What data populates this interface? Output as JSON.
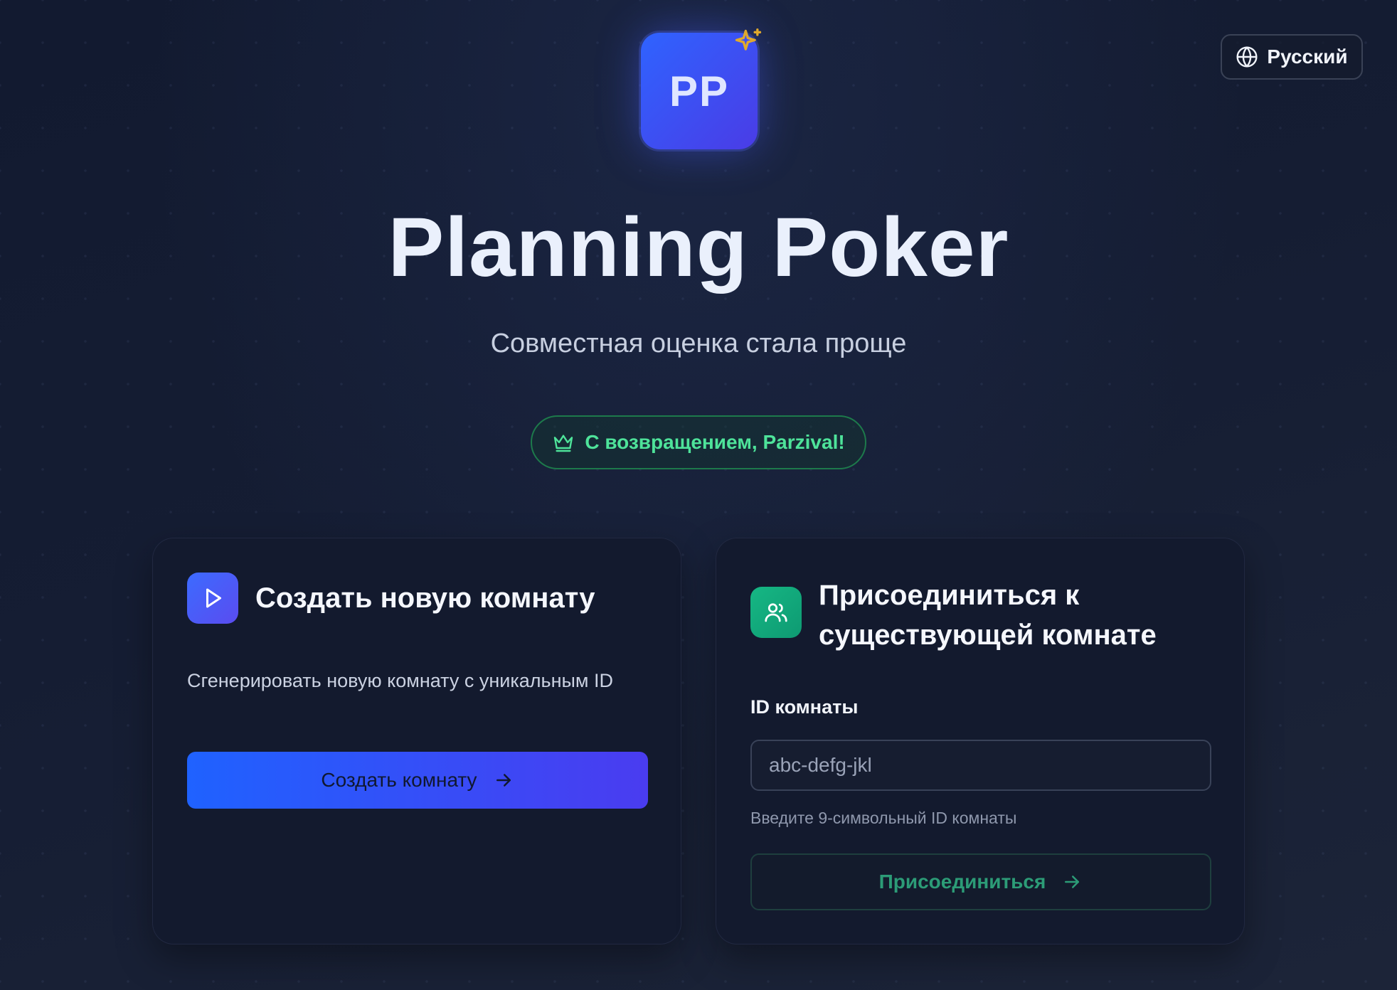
{
  "header": {
    "language_label": "Русский",
    "logo_text": "PP",
    "title": "Planning Poker",
    "subtitle": "Совместная оценка стала проще",
    "welcome": "С возвращением, Parzival!"
  },
  "create_card": {
    "title": "Создать новую комнату",
    "description": "Сгенерировать новую комнату с уникальным ID",
    "button_label": "Создать комнату"
  },
  "join_card": {
    "title": "Присоединиться к существующей комнате",
    "field_label": "ID комнаты",
    "input_placeholder": "abc-defg-jkl",
    "hint": "Введите 9-символьный ID комнаты",
    "button_label": "Присоединиться"
  },
  "colors": {
    "primary_gradient_start": "#1f62ff",
    "primary_gradient_end": "#4a3cf0",
    "success_green": "#4ee39a",
    "join_teal": "#16b784",
    "sparkle_gold": "#e0a92c"
  }
}
